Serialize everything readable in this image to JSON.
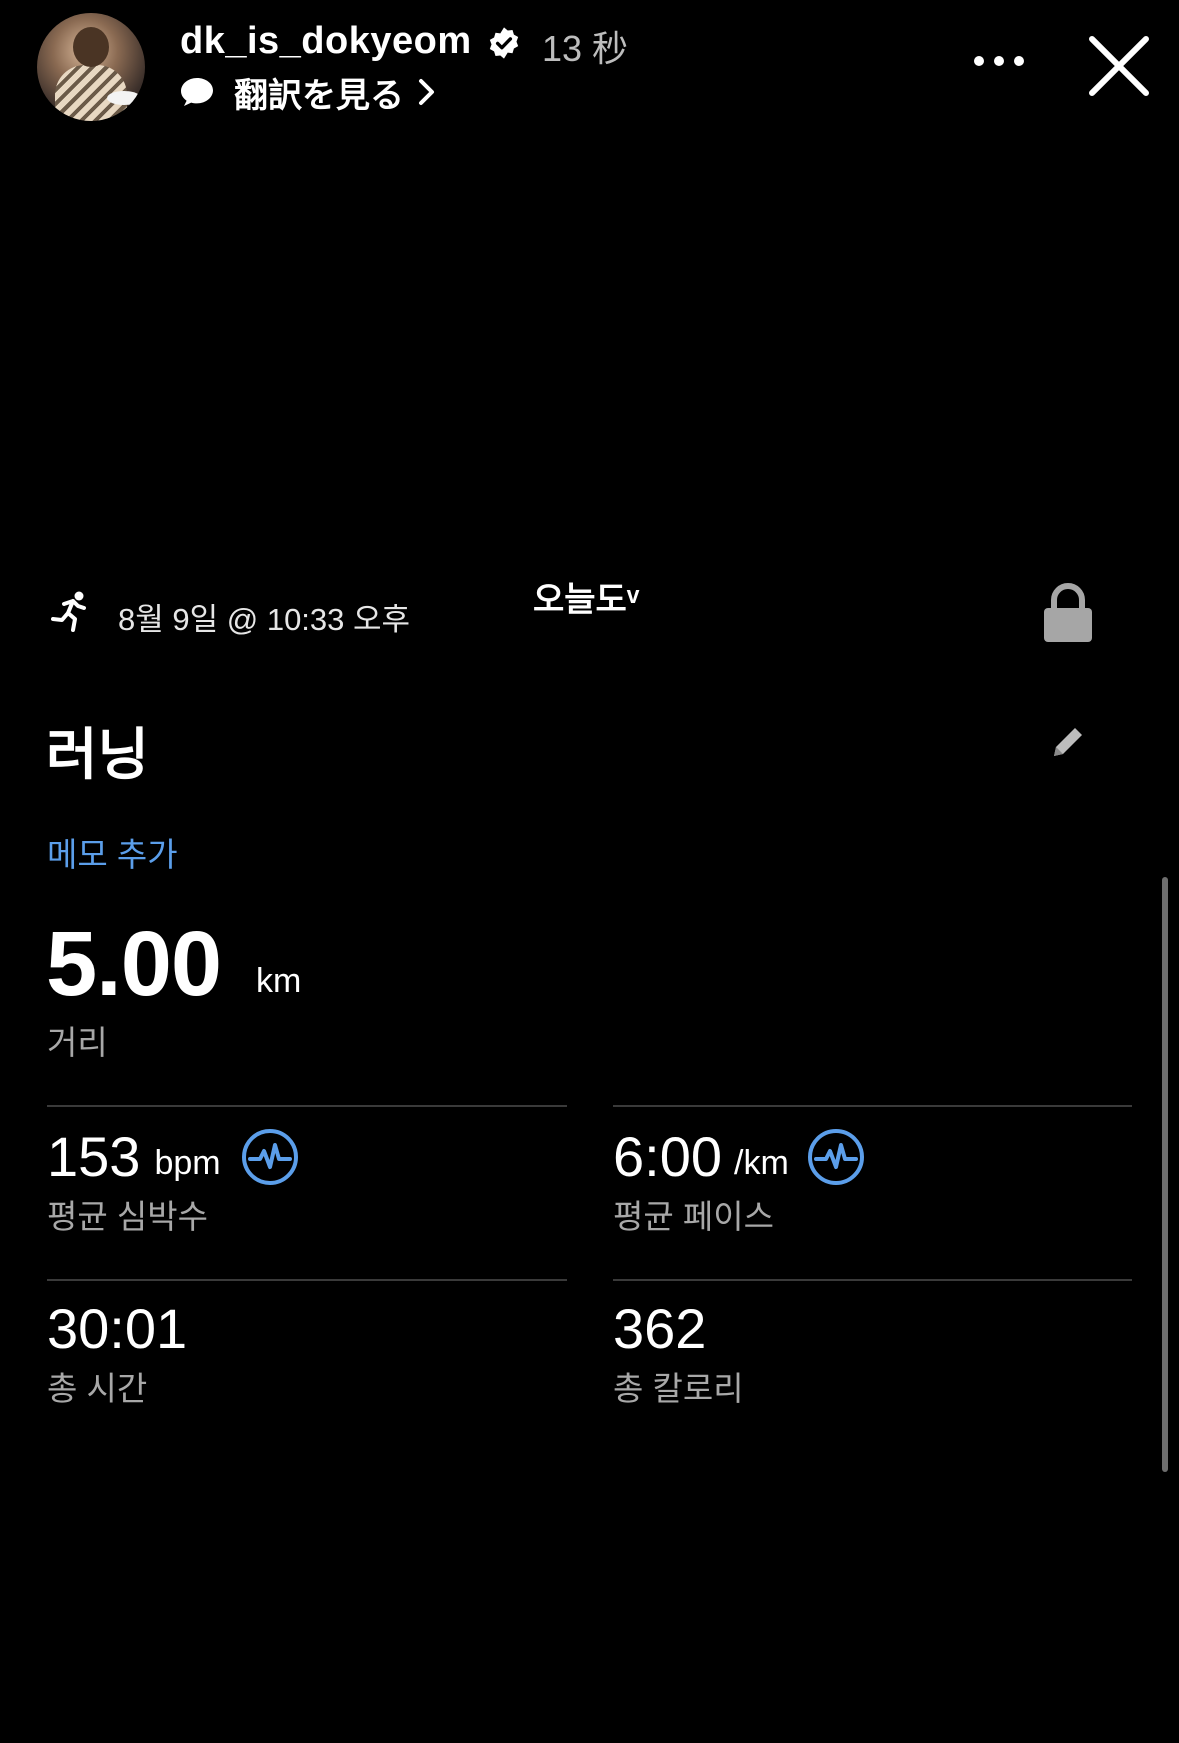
{
  "story": {
    "username": "dk_is_dokyeom",
    "time": "13 秒",
    "translate_label": "翻訳を見る"
  },
  "sticker_text": "오늘도ᵛ",
  "workout": {
    "date": "8월 9일 @ 10:33 오후",
    "title": "러닝",
    "memo_link": "메모 추가",
    "distance": {
      "value": "5.00",
      "unit": "km",
      "label": "거리"
    },
    "heart_rate": {
      "value": "153",
      "unit": "bpm",
      "label": "평균 심박수"
    },
    "pace": {
      "value": "6:00",
      "unit": "/km",
      "label": "평균 페이스"
    },
    "duration": {
      "value": "30:01",
      "label": "총 시간"
    },
    "calories": {
      "value": "362",
      "label": "총 칼로리"
    }
  },
  "icons": {
    "verified": "verified-badge-icon",
    "translate": "speech-bubble-icon",
    "run": "running-person-icon",
    "lock": "lock-icon",
    "edit": "pencil-icon",
    "pulse": "heart-rate-pulse-icon"
  },
  "colors": {
    "background": "#000000",
    "accent_blue": "#5b9eea",
    "label_gray": "#a8a8a8"
  }
}
